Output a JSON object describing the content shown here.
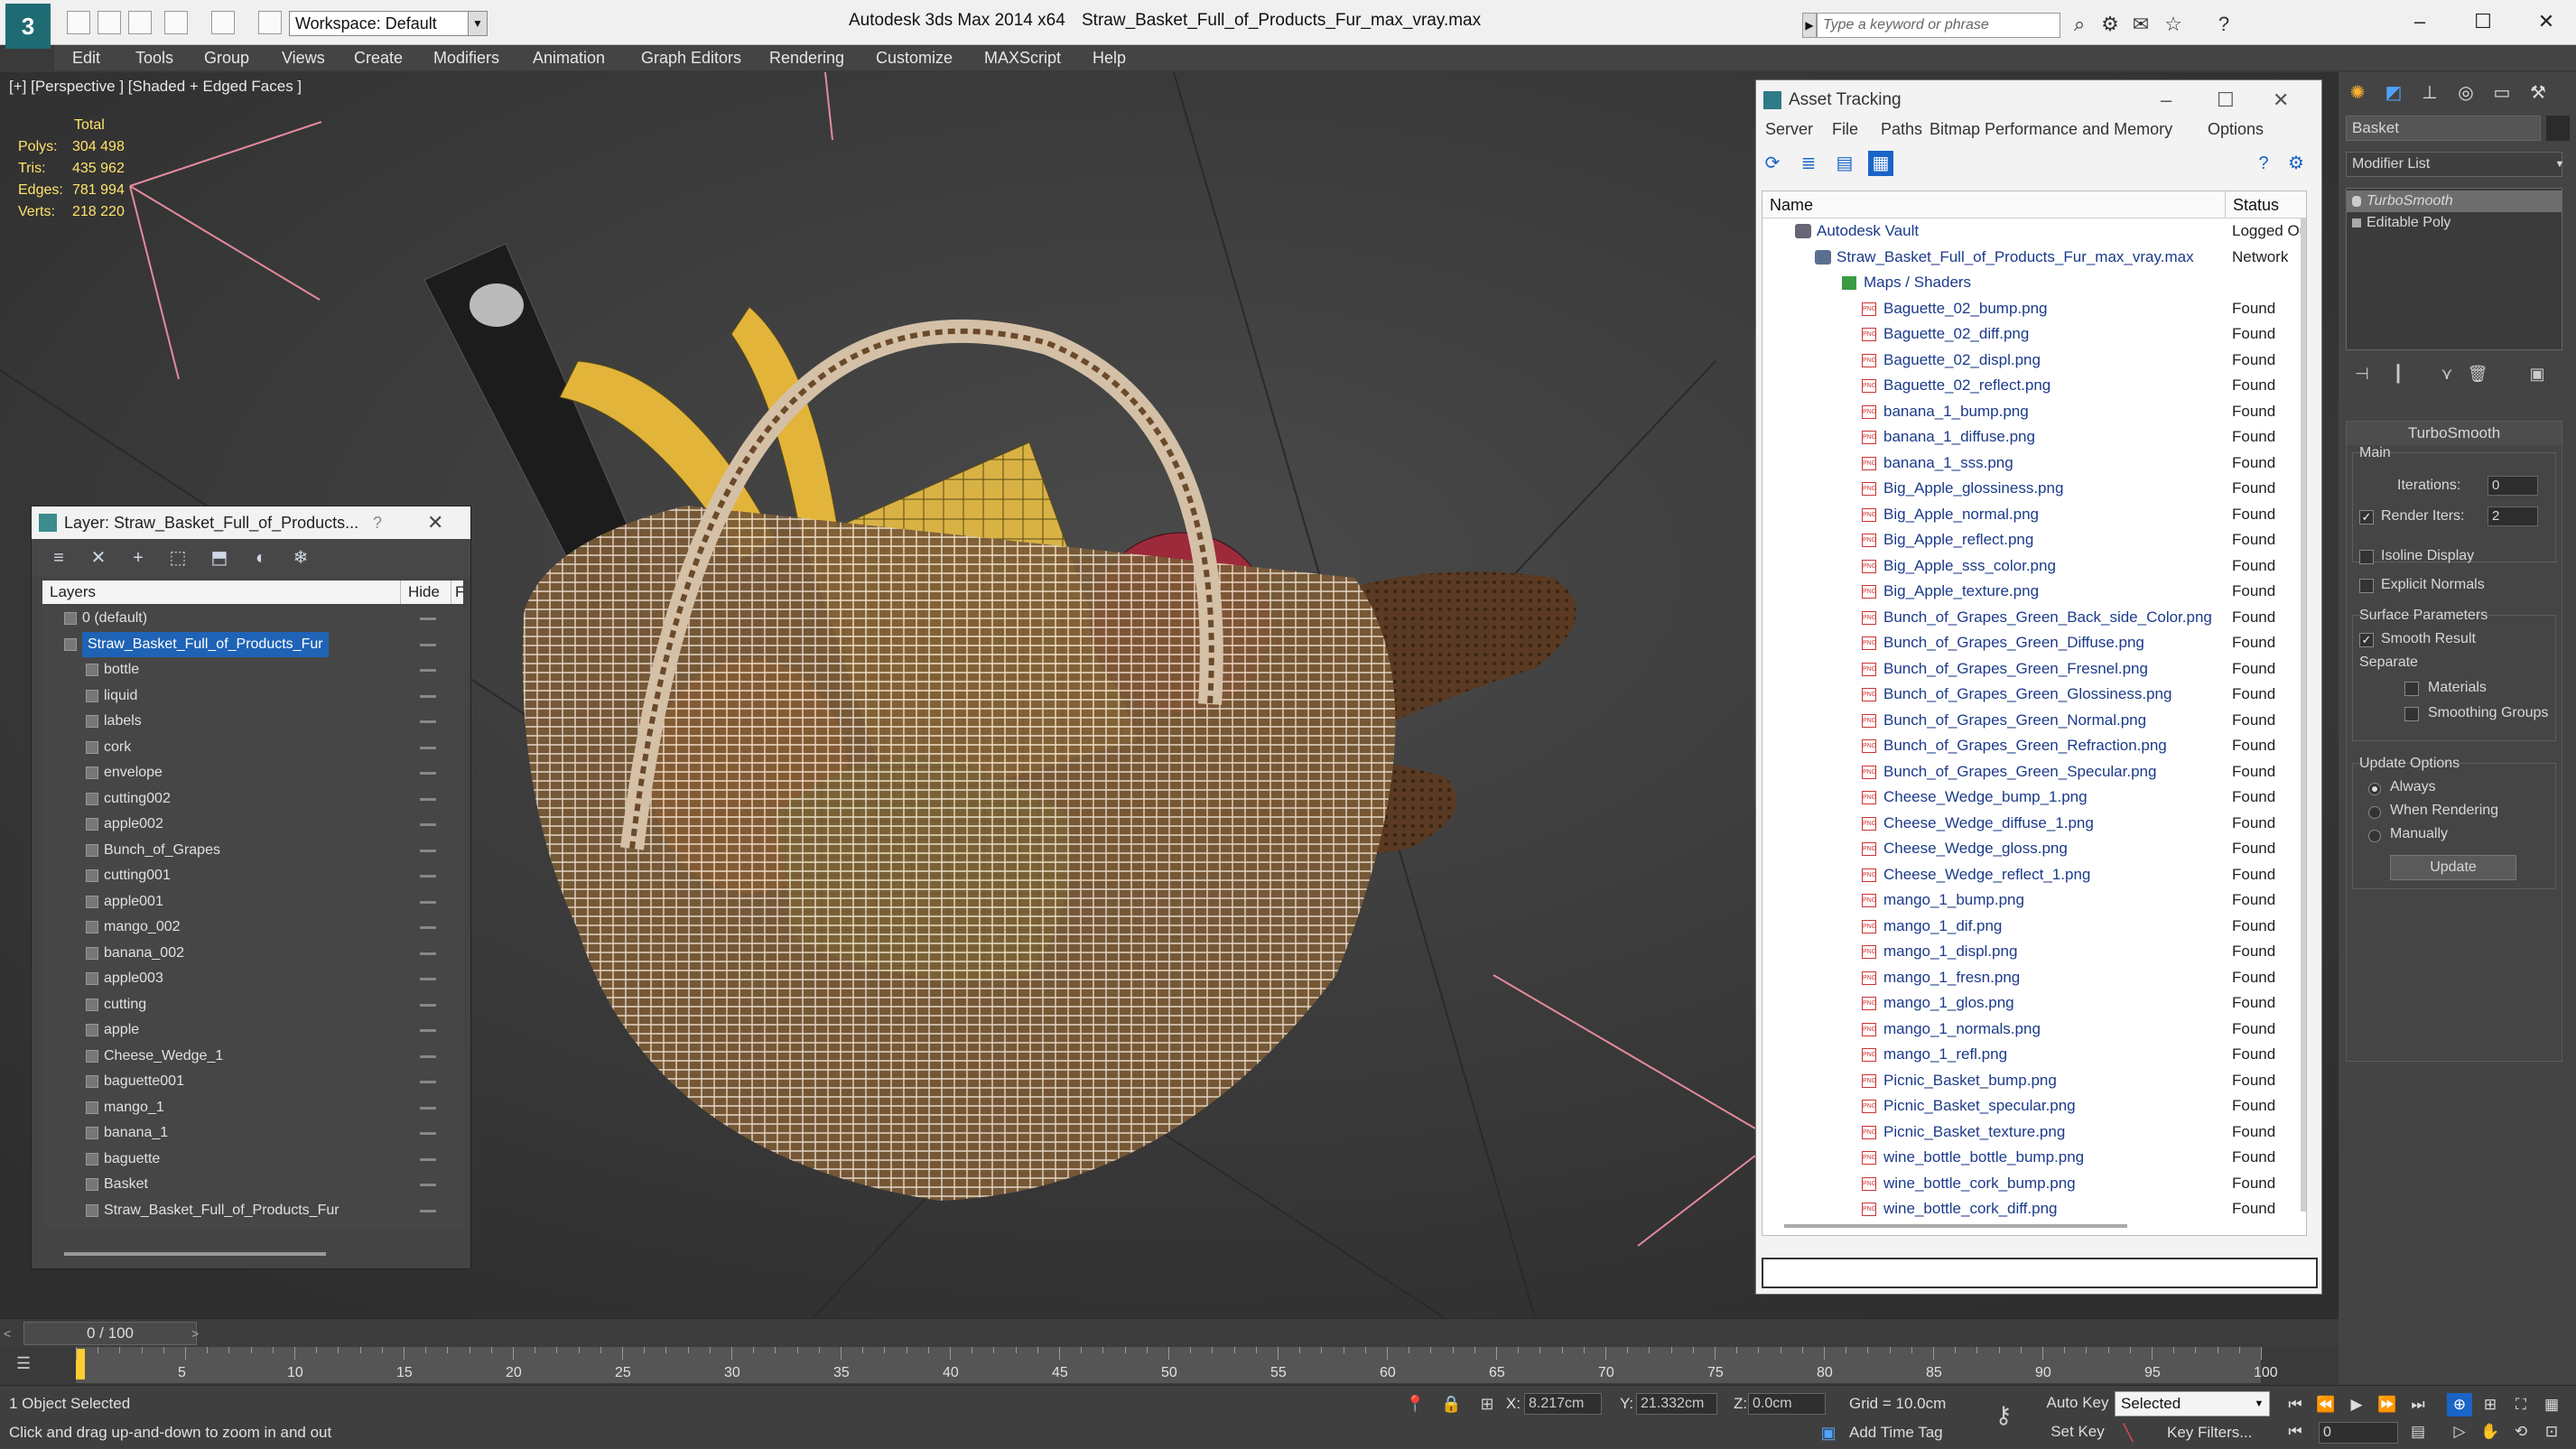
{
  "window": {
    "app_title": "Autodesk 3ds Max  2014 x64",
    "file_title": "Straw_Basket_Full_of_Products_Fur_max_vray.max",
    "workspace": "Workspace: Default",
    "search_placeholder": "Type a keyword or phrase",
    "logo_letter": "3"
  },
  "menu": [
    "Edit",
    "Tools",
    "Group",
    "Views",
    "Create",
    "Modifiers",
    "Animation",
    "Graph Editors",
    "Rendering",
    "Customize",
    "MAXScript",
    "Help"
  ],
  "viewport": {
    "label": "[+] [Perspective ] [Shaded + Edged Faces ]",
    "stats": {
      "total_label": "Total",
      "rows": [
        {
          "k": "Polys:",
          "v": "304 498"
        },
        {
          "k": "Tris:",
          "v": "435 962"
        },
        {
          "k": "Edges:",
          "v": "781 994"
        },
        {
          "k": "Verts:",
          "v": "218 220"
        }
      ]
    }
  },
  "layer_panel": {
    "title": "Layer: Straw_Basket_Full_of_Products...",
    "help": "?",
    "close": "✕",
    "col_layers": "Layers",
    "col_hide": "Hide",
    "col_f": "F",
    "rows": [
      {
        "name": "0 (default)",
        "level": 0
      },
      {
        "name": "Straw_Basket_Full_of_Products_Fur",
        "level": 0,
        "selected": true
      },
      {
        "name": "bottle",
        "level": 1
      },
      {
        "name": "liquid",
        "level": 1
      },
      {
        "name": "labels",
        "level": 1
      },
      {
        "name": "cork",
        "level": 1
      },
      {
        "name": "envelope",
        "level": 1
      },
      {
        "name": "cutting002",
        "level": 1
      },
      {
        "name": "apple002",
        "level": 1
      },
      {
        "name": "Bunch_of_Grapes",
        "level": 1
      },
      {
        "name": "cutting001",
        "level": 1
      },
      {
        "name": "apple001",
        "level": 1
      },
      {
        "name": "mango_002",
        "level": 1
      },
      {
        "name": "banana_002",
        "level": 1
      },
      {
        "name": "apple003",
        "level": 1
      },
      {
        "name": "cutting",
        "level": 1
      },
      {
        "name": "apple",
        "level": 1
      },
      {
        "name": "Cheese_Wedge_1",
        "level": 1
      },
      {
        "name": "baguette001",
        "level": 1
      },
      {
        "name": "mango_1",
        "level": 1
      },
      {
        "name": "banana_1",
        "level": 1
      },
      {
        "name": "baguette",
        "level": 1
      },
      {
        "name": "Basket",
        "level": 1
      },
      {
        "name": "Straw_Basket_Full_of_Products_Fur",
        "level": 1
      }
    ]
  },
  "asset_panel": {
    "title": "Asset Tracking",
    "menu": [
      "Server",
      "File",
      "Paths",
      "Bitmap Performance and Memory",
      "Options"
    ],
    "col_name": "Name",
    "col_status": "Status",
    "rows": [
      {
        "name": "Autodesk Vault",
        "status": "Logged Out",
        "level": 0,
        "kind": "vault"
      },
      {
        "name": "Straw_Basket_Full_of_Products_Fur_max_vray.max",
        "status": "Network",
        "level": 1,
        "kind": "file"
      },
      {
        "name": "Maps / Shaders",
        "status": "",
        "level": 2,
        "kind": "group"
      },
      {
        "name": "Baguette_02_bump.png",
        "status": "Found",
        "level": 3,
        "kind": "png"
      },
      {
        "name": "Baguette_02_diff.png",
        "status": "Found",
        "level": 3,
        "kind": "png"
      },
      {
        "name": "Baguette_02_displ.png",
        "status": "Found",
        "level": 3,
        "kind": "png"
      },
      {
        "name": "Baguette_02_reflect.png",
        "status": "Found",
        "level": 3,
        "kind": "png"
      },
      {
        "name": "banana_1_bump.png",
        "status": "Found",
        "level": 3,
        "kind": "png"
      },
      {
        "name": "banana_1_diffuse.png",
        "status": "Found",
        "level": 3,
        "kind": "png"
      },
      {
        "name": "banana_1_sss.png",
        "status": "Found",
        "level": 3,
        "kind": "png"
      },
      {
        "name": "Big_Apple_glossiness.png",
        "status": "Found",
        "level": 3,
        "kind": "png"
      },
      {
        "name": "Big_Apple_normal.png",
        "status": "Found",
        "level": 3,
        "kind": "png"
      },
      {
        "name": "Big_Apple_reflect.png",
        "status": "Found",
        "level": 3,
        "kind": "png"
      },
      {
        "name": "Big_Apple_sss_color.png",
        "status": "Found",
        "level": 3,
        "kind": "png"
      },
      {
        "name": "Big_Apple_texture.png",
        "status": "Found",
        "level": 3,
        "kind": "png"
      },
      {
        "name": "Bunch_of_Grapes_Green_Back_side_Color.png",
        "status": "Found",
        "level": 3,
        "kind": "png"
      },
      {
        "name": "Bunch_of_Grapes_Green_Diffuse.png",
        "status": "Found",
        "level": 3,
        "kind": "png"
      },
      {
        "name": "Bunch_of_Grapes_Green_Fresnel.png",
        "status": "Found",
        "level": 3,
        "kind": "png"
      },
      {
        "name": "Bunch_of_Grapes_Green_Glossiness.png",
        "status": "Found",
        "level": 3,
        "kind": "png"
      },
      {
        "name": "Bunch_of_Grapes_Green_Normal.png",
        "status": "Found",
        "level": 3,
        "kind": "png"
      },
      {
        "name": "Bunch_of_Grapes_Green_Refraction.png",
        "status": "Found",
        "level": 3,
        "kind": "png"
      },
      {
        "name": "Bunch_of_Grapes_Green_Specular.png",
        "status": "Found",
        "level": 3,
        "kind": "png"
      },
      {
        "name": "Cheese_Wedge_bump_1.png",
        "status": "Found",
        "level": 3,
        "kind": "png"
      },
      {
        "name": "Cheese_Wedge_diffuse_1.png",
        "status": "Found",
        "level": 3,
        "kind": "png"
      },
      {
        "name": "Cheese_Wedge_gloss.png",
        "status": "Found",
        "level": 3,
        "kind": "png"
      },
      {
        "name": "Cheese_Wedge_reflect_1.png",
        "status": "Found",
        "level": 3,
        "kind": "png"
      },
      {
        "name": "mango_1_bump.png",
        "status": "Found",
        "level": 3,
        "kind": "png"
      },
      {
        "name": "mango_1_dif.png",
        "status": "Found",
        "level": 3,
        "kind": "png"
      },
      {
        "name": "mango_1_displ.png",
        "status": "Found",
        "level": 3,
        "kind": "png"
      },
      {
        "name": "mango_1_fresn.png",
        "status": "Found",
        "level": 3,
        "kind": "png"
      },
      {
        "name": "mango_1_glos.png",
        "status": "Found",
        "level": 3,
        "kind": "png"
      },
      {
        "name": "mango_1_normals.png",
        "status": "Found",
        "level": 3,
        "kind": "png"
      },
      {
        "name": "mango_1_refl.png",
        "status": "Found",
        "level": 3,
        "kind": "png"
      },
      {
        "name": "Picnic_Basket_bump.png",
        "status": "Found",
        "level": 3,
        "kind": "png"
      },
      {
        "name": "Picnic_Basket_specular.png",
        "status": "Found",
        "level": 3,
        "kind": "png"
      },
      {
        "name": "Picnic_Basket_texture.png",
        "status": "Found",
        "level": 3,
        "kind": "png"
      },
      {
        "name": "wine_bottle_bottle_bump.png",
        "status": "Found",
        "level": 3,
        "kind": "png"
      },
      {
        "name": "wine_bottle_cork_bump.png",
        "status": "Found",
        "level": 3,
        "kind": "png"
      },
      {
        "name": "wine_bottle_cork_diff.png",
        "status": "Found",
        "level": 3,
        "kind": "png"
      }
    ]
  },
  "command_panel": {
    "object_name": "Basket",
    "modifier_list": "Modifier List",
    "stack": [
      "TurboSmooth",
      "Editable Poly"
    ],
    "turbosmooth": {
      "title": "TurboSmooth",
      "main": "Main",
      "iterations_label": "Iterations:",
      "iterations_value": "0",
      "render_iters_label": "Render Iters:",
      "render_iters_value": "2",
      "isoline": "Isoline Display",
      "explicit": "Explicit Normals",
      "surface": "Surface Parameters",
      "smooth_result": "Smooth Result",
      "separate": "Separate",
      "materials": "Materials",
      "smoothing_groups": "Smoothing Groups",
      "update_options": "Update Options",
      "always": "Always",
      "when_rendering": "When Rendering",
      "manually": "Manually",
      "update": "Update"
    }
  },
  "timeline": {
    "frame_display": "0 / 100",
    "ticks": [
      "5",
      "10",
      "15",
      "20",
      "25",
      "30",
      "35",
      "40",
      "45",
      "50",
      "55",
      "60",
      "65",
      "70",
      "75",
      "80",
      "85",
      "90",
      "95",
      "100"
    ]
  },
  "status": {
    "selected": "1 Object Selected",
    "prompt": "Click and drag up-and-down to zoom in and out",
    "x_label": "X:",
    "x_value": "8.217cm",
    "y_label": "Y:",
    "y_value": "21.332cm",
    "z_label": "Z:",
    "z_value": "0.0cm",
    "grid": "Grid = 10.0cm",
    "add_time_tag": "Add Time Tag",
    "auto_key": "Auto Key",
    "set_key": "Set Key",
    "selected_mode": "Selected",
    "key_filters": "Key Filters...",
    "frame": "0"
  },
  "colors": {
    "selection_blue": "#1e63b6",
    "stats_yellow": "#ffe36a",
    "active_blue": "#1a64c7"
  }
}
